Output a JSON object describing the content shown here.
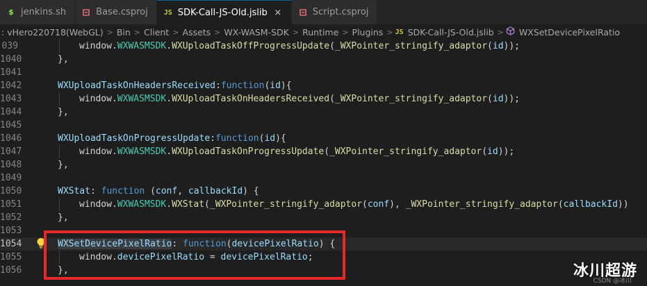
{
  "tabs": [
    {
      "label": "jenkins.sh",
      "icon": "shell-file-icon",
      "active": false
    },
    {
      "label": "Base.csproj",
      "icon": "csproj-file-icon",
      "active": false
    },
    {
      "label": "SDK-Call-JS-Old.jslib",
      "icon": "js-file-icon",
      "icon_text": "JS",
      "active": true
    },
    {
      "label": "Script.csproj",
      "icon": "csproj-file-icon",
      "active": false
    }
  ],
  "close_glyph": "×",
  "breadcrumb": {
    "items": [
      ":",
      "vHero220718(WebGL)",
      "Bin",
      "Client",
      "Assets",
      "WX-WASM-SDK",
      "Runtime",
      "Plugins"
    ],
    "file_icon_text": "JS",
    "file": "SDK-Call-JS-Old.jslib",
    "symbol": "WXSetDevicePixelRatio",
    "separator": ">"
  },
  "editor": {
    "current_line": "1054",
    "lines": [
      {
        "num": "039",
        "indent": 2,
        "tokens": [
          [
            "window.",
            "p"
          ],
          [
            "WXWASMSDK",
            "t"
          ],
          [
            ".",
            ""
          ],
          [
            "WXUploadTaskOffProgressUpdate",
            "f"
          ],
          [
            "(",
            "p"
          ],
          [
            "_WXPointer_stringify_adaptor",
            "f"
          ],
          [
            "(",
            "p"
          ],
          [
            "id",
            "v"
          ],
          [
            "));",
            "p"
          ]
        ]
      },
      {
        "num": "1040",
        "indent": 1,
        "tokens": [
          [
            "},",
            "p"
          ]
        ]
      },
      {
        "num": "1041",
        "indent": 0,
        "tokens": []
      },
      {
        "num": "1042",
        "indent": 1,
        "tokens": [
          [
            "WXUploadTaskOnHeadersReceived",
            "v"
          ],
          [
            ":",
            "p"
          ],
          [
            "function",
            "k"
          ],
          [
            "(",
            "p"
          ],
          [
            "id",
            "v"
          ],
          [
            "){",
            "p"
          ]
        ]
      },
      {
        "num": "1043",
        "indent": 2,
        "tokens": [
          [
            "window.",
            "p"
          ],
          [
            "WXWASMSDK",
            "t"
          ],
          [
            ".",
            ""
          ],
          [
            "WXUploadTaskOnHeadersReceived",
            "f"
          ],
          [
            "(",
            "p"
          ],
          [
            "_WXPointer_stringify_adaptor",
            "f"
          ],
          [
            "(",
            "p"
          ],
          [
            "id",
            "v"
          ],
          [
            "));",
            "p"
          ]
        ]
      },
      {
        "num": "1044",
        "indent": 1,
        "tokens": [
          [
            "},",
            "p"
          ]
        ]
      },
      {
        "num": "1045",
        "indent": 0,
        "tokens": []
      },
      {
        "num": "1046",
        "indent": 1,
        "tokens": [
          [
            "WXUploadTaskOnProgressUpdate",
            "v"
          ],
          [
            ":",
            "p"
          ],
          [
            "function",
            "k"
          ],
          [
            "(",
            "p"
          ],
          [
            "id",
            "v"
          ],
          [
            "){",
            "p"
          ]
        ]
      },
      {
        "num": "1047",
        "indent": 2,
        "tokens": [
          [
            "window.",
            "p"
          ],
          [
            "WXWASMSDK",
            "t"
          ],
          [
            ".",
            ""
          ],
          [
            "WXUploadTaskOnProgressUpdate",
            "f"
          ],
          [
            "(",
            "p"
          ],
          [
            "_WXPointer_stringify_adaptor",
            "f"
          ],
          [
            "(",
            "p"
          ],
          [
            "id",
            "v"
          ],
          [
            "));",
            "p"
          ]
        ]
      },
      {
        "num": "1048",
        "indent": 1,
        "tokens": [
          [
            "},",
            "p"
          ]
        ]
      },
      {
        "num": "1049",
        "indent": 0,
        "tokens": []
      },
      {
        "num": "1050",
        "indent": 1,
        "tokens": [
          [
            "WXStat",
            "v"
          ],
          [
            ": ",
            "p"
          ],
          [
            "function",
            "k"
          ],
          [
            " (",
            "p"
          ],
          [
            "conf",
            "v"
          ],
          [
            ", ",
            "p"
          ],
          [
            "callbackId",
            "v"
          ],
          [
            ") {",
            "p"
          ]
        ]
      },
      {
        "num": "1051",
        "indent": 2,
        "tokens": [
          [
            "window.",
            "p"
          ],
          [
            "WXWASMSDK",
            "t"
          ],
          [
            ".",
            ""
          ],
          [
            "WXStat",
            "f"
          ],
          [
            "(",
            "p"
          ],
          [
            "_WXPointer_stringify_adaptor",
            "f"
          ],
          [
            "(",
            "p"
          ],
          [
            "conf",
            "v"
          ],
          [
            "), ",
            "p"
          ],
          [
            "_WXPointer_stringify_adaptor",
            "f"
          ],
          [
            "(",
            "p"
          ],
          [
            "callbackId",
            "v"
          ],
          [
            "))",
            "p"
          ]
        ]
      },
      {
        "num": "1052",
        "indent": 1,
        "tokens": [
          [
            "},",
            "p"
          ]
        ]
      },
      {
        "num": "1053",
        "indent": 0,
        "tokens": []
      },
      {
        "num": "1054",
        "indent": 1,
        "tokens": [
          [
            "WXSetDevicePixelRatio",
            "vh"
          ],
          [
            ": ",
            "p"
          ],
          [
            "function",
            "k"
          ],
          [
            "(",
            "p"
          ],
          [
            "devicePixelRatio",
            "v"
          ],
          [
            ") {",
            "p"
          ]
        ]
      },
      {
        "num": "1055",
        "indent": 2,
        "tokens": [
          [
            "window.",
            "p"
          ],
          [
            "devicePixelRatio",
            "v"
          ],
          [
            " = ",
            "p"
          ],
          [
            "devicePixelRatio",
            "v"
          ],
          [
            ";",
            "p"
          ]
        ]
      },
      {
        "num": "1056",
        "indent": 1,
        "tokens": [
          [
            "},",
            "p"
          ]
        ]
      }
    ]
  },
  "watermark": {
    "text": "冰川超游",
    "sub": "CSDN @冰川"
  },
  "colors": {
    "highlight_box": "#e8272a",
    "lightbulb": "#f9d342"
  }
}
